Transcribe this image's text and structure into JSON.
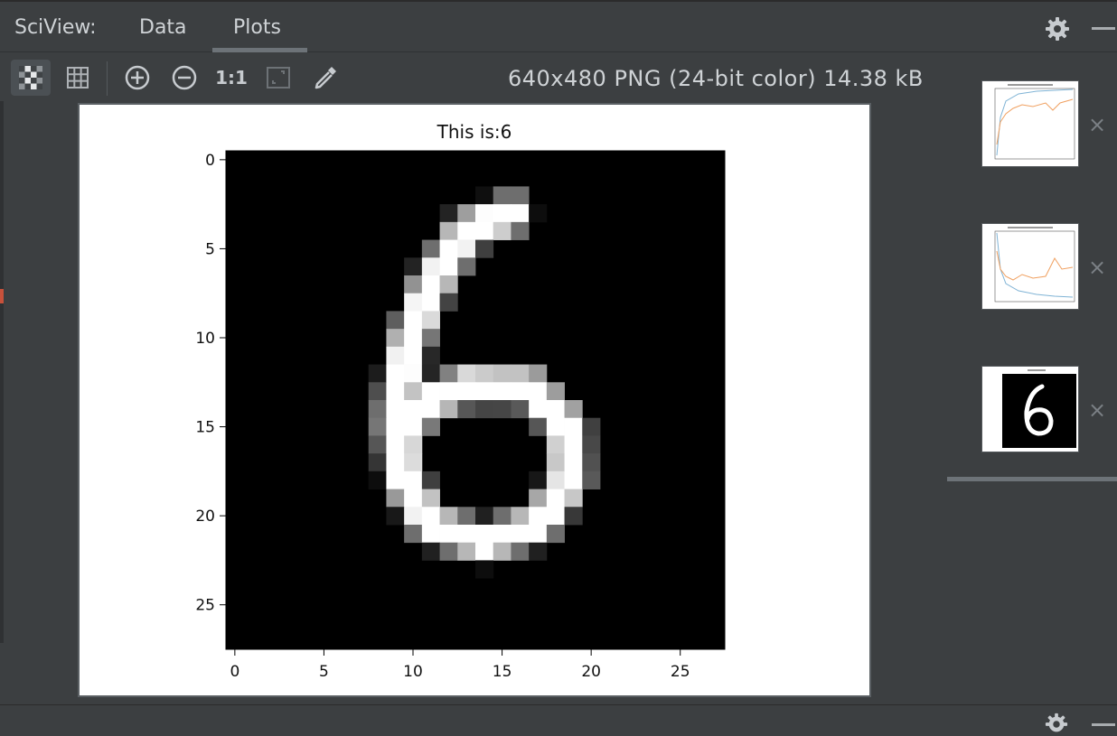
{
  "header": {
    "app_title": "SciView:",
    "tabs": [
      {
        "label": "Data"
      },
      {
        "label": "Plots"
      }
    ]
  },
  "toolbar": {
    "actual_size_label": "1:1",
    "image_info": "640x480 PNG (24-bit color) 14.38 kB"
  },
  "plot": {
    "title": "This is:6",
    "x_ticks": [
      "0",
      "5",
      "10",
      "15",
      "20",
      "25"
    ],
    "y_ticks": [
      "0",
      "5",
      "10",
      "15",
      "20",
      "25"
    ]
  },
  "thumbnails": [
    {
      "close": "×"
    },
    {
      "close": "×"
    },
    {
      "close": "×"
    }
  ],
  "colors": {
    "background": "#3c3f41",
    "accent_underline": "#6d7378",
    "text": "#cfd3d6"
  }
}
